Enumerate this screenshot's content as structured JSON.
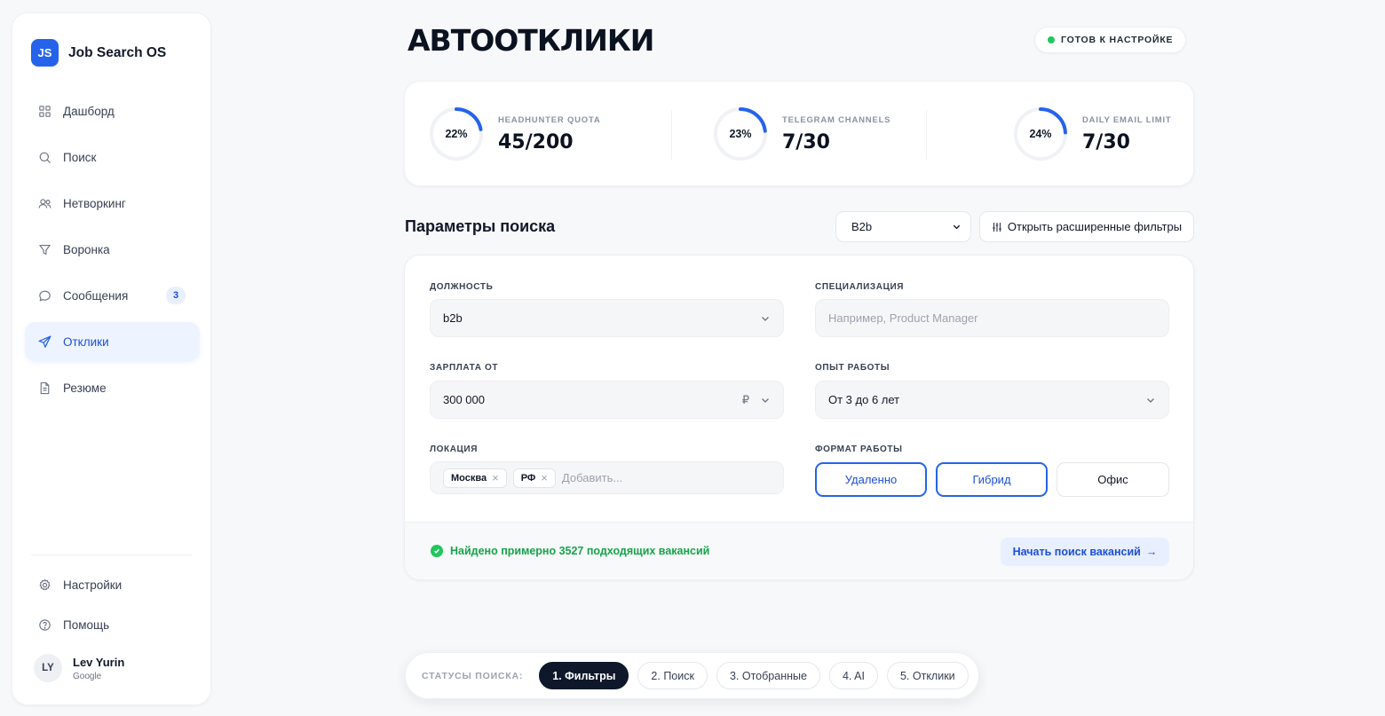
{
  "brand": {
    "logo": "JS",
    "name": "Job Search OS"
  },
  "nav": [
    {
      "label": "Дашборд",
      "icon": "grid-icon"
    },
    {
      "label": "Поиск",
      "icon": "search-icon"
    },
    {
      "label": "Нетворкинг",
      "icon": "users-icon"
    },
    {
      "label": "Воронка",
      "icon": "funnel-icon"
    },
    {
      "label": "Сообщения",
      "icon": "chat-icon",
      "badge": "3"
    },
    {
      "label": "Отклики",
      "icon": "send-icon",
      "active": true
    },
    {
      "label": "Резюме",
      "icon": "document-icon"
    }
  ],
  "bottom_nav": [
    {
      "label": "Настройки",
      "icon": "gear-icon"
    },
    {
      "label": "Помощь",
      "icon": "help-icon"
    }
  ],
  "user": {
    "initials": "LY",
    "name": "Lev Yurin",
    "provider": "Google"
  },
  "header": {
    "title": "АВТООТКЛИКИ",
    "status": "ГОТОВ К НАСТРОЙКЕ",
    "status_color": "#22c55e"
  },
  "quotas": [
    {
      "label": "HEADHUNTER QUOTA",
      "value": "45/200",
      "percent": 22,
      "percent_label": "22%"
    },
    {
      "label": "TELEGRAM CHANNELS",
      "value": "7/30",
      "percent": 23,
      "percent_label": "23%"
    },
    {
      "label": "DAILY EMAIL LIMIT",
      "value": "7/30",
      "percent": 24,
      "percent_label": "24%"
    }
  ],
  "search": {
    "title": "Параметры поиска",
    "preset": "B2b",
    "advanced_filters_label": "Открыть расширенные фильтры"
  },
  "form": {
    "position_label": "ДОЛЖНОСТЬ",
    "position_value": "b2b",
    "specialization_label": "СПЕЦИАЛИЗАЦИЯ",
    "specialization_placeholder": "Например, Product Manager",
    "salary_label": "ЗАРПЛАТА ОТ",
    "salary_value": "300 000",
    "salary_currency": "₽",
    "experience_label": "ОПЫТ РАБОТЫ",
    "experience_value": "От 3 до 6 лет",
    "location_label": "ЛОКАЦИЯ",
    "location_tags": [
      "Москва",
      "РФ"
    ],
    "location_add_placeholder": "Добавить...",
    "format_label": "ФОРМАТ РАБОТЫ",
    "formats": [
      {
        "label": "Удаленно",
        "selected": true
      },
      {
        "label": "Гибрид",
        "selected": true
      },
      {
        "label": "Офис",
        "selected": false
      }
    ]
  },
  "footer": {
    "found_text": "Найдено примерно 3527 подходящих вакансий",
    "start_label": "Начать поиск вакансий",
    "start_arrow": "→"
  },
  "status_bar": {
    "label": "СТАТУСЫ ПОИСКА:",
    "steps": [
      {
        "label": "1. Фильтры",
        "active": true
      },
      {
        "label": "2. Поиск",
        "active": false
      },
      {
        "label": "3. Отобранные",
        "active": false
      },
      {
        "label": "4. AI",
        "active": false
      },
      {
        "label": "5. Отклики",
        "active": false
      }
    ]
  },
  "colors": {
    "accent": "#2563eb",
    "success": "#16a34a",
    "dark": "#0f172a"
  }
}
